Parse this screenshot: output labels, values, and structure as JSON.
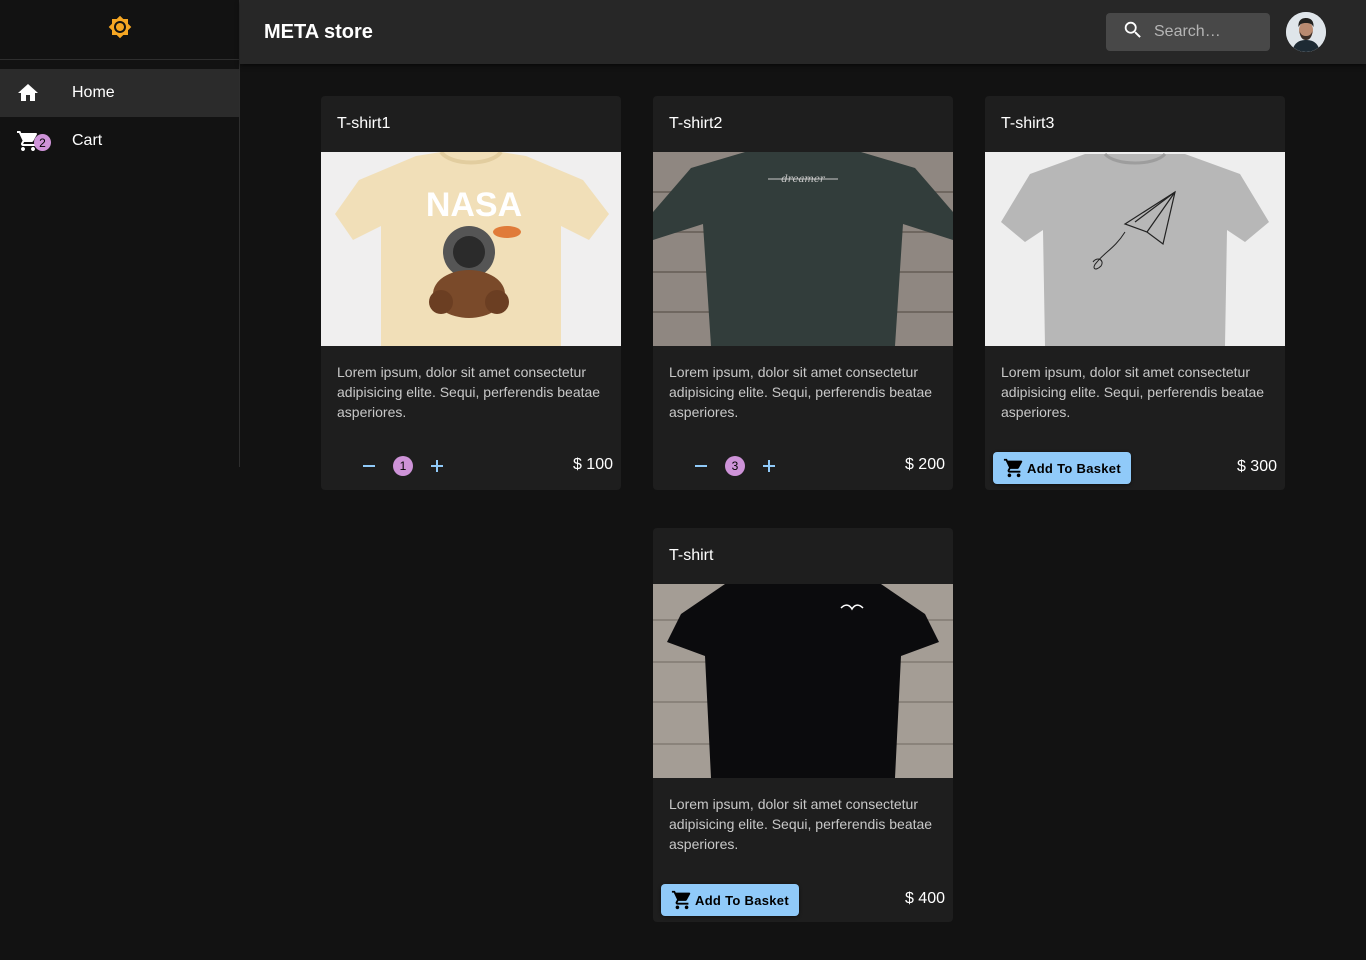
{
  "app": {
    "title": "META store"
  },
  "search": {
    "placeholder": "Search…"
  },
  "sidebar": {
    "items": [
      {
        "label": "Home",
        "icon": "home-icon",
        "active": true
      },
      {
        "label": "Cart",
        "icon": "cart-icon",
        "badge": "2"
      }
    ]
  },
  "colors": {
    "accent": "#90caf9",
    "badge": "#ce93d8",
    "sun": "#f5a623"
  },
  "products": [
    {
      "title": "T-shirt1",
      "description": "Lorem ipsum, dolor sit amet consectetur adipisicing elite. Sequi, perferendis beatae asperiores.",
      "price": "$ 100",
      "quantity": "1"
    },
    {
      "title": "T-shirt2",
      "description": "Lorem ipsum, dolor sit amet consectetur adipisicing elite. Sequi, perferendis beatae asperiores.",
      "price": "$ 200",
      "quantity": "3"
    },
    {
      "title": "T-shirt3",
      "description": "Lorem ipsum, dolor sit amet consectetur adipisicing elite. Sequi, perferendis beatae asperiores.",
      "price": "$ 300",
      "button": "Add To Basket"
    },
    {
      "title": "T-shirt",
      "description": "Lorem ipsum, dolor sit amet consectetur adipisicing elite. Sequi, perferendis beatae asperiores.",
      "price": "$ 400",
      "button": "Add To Basket"
    }
  ]
}
